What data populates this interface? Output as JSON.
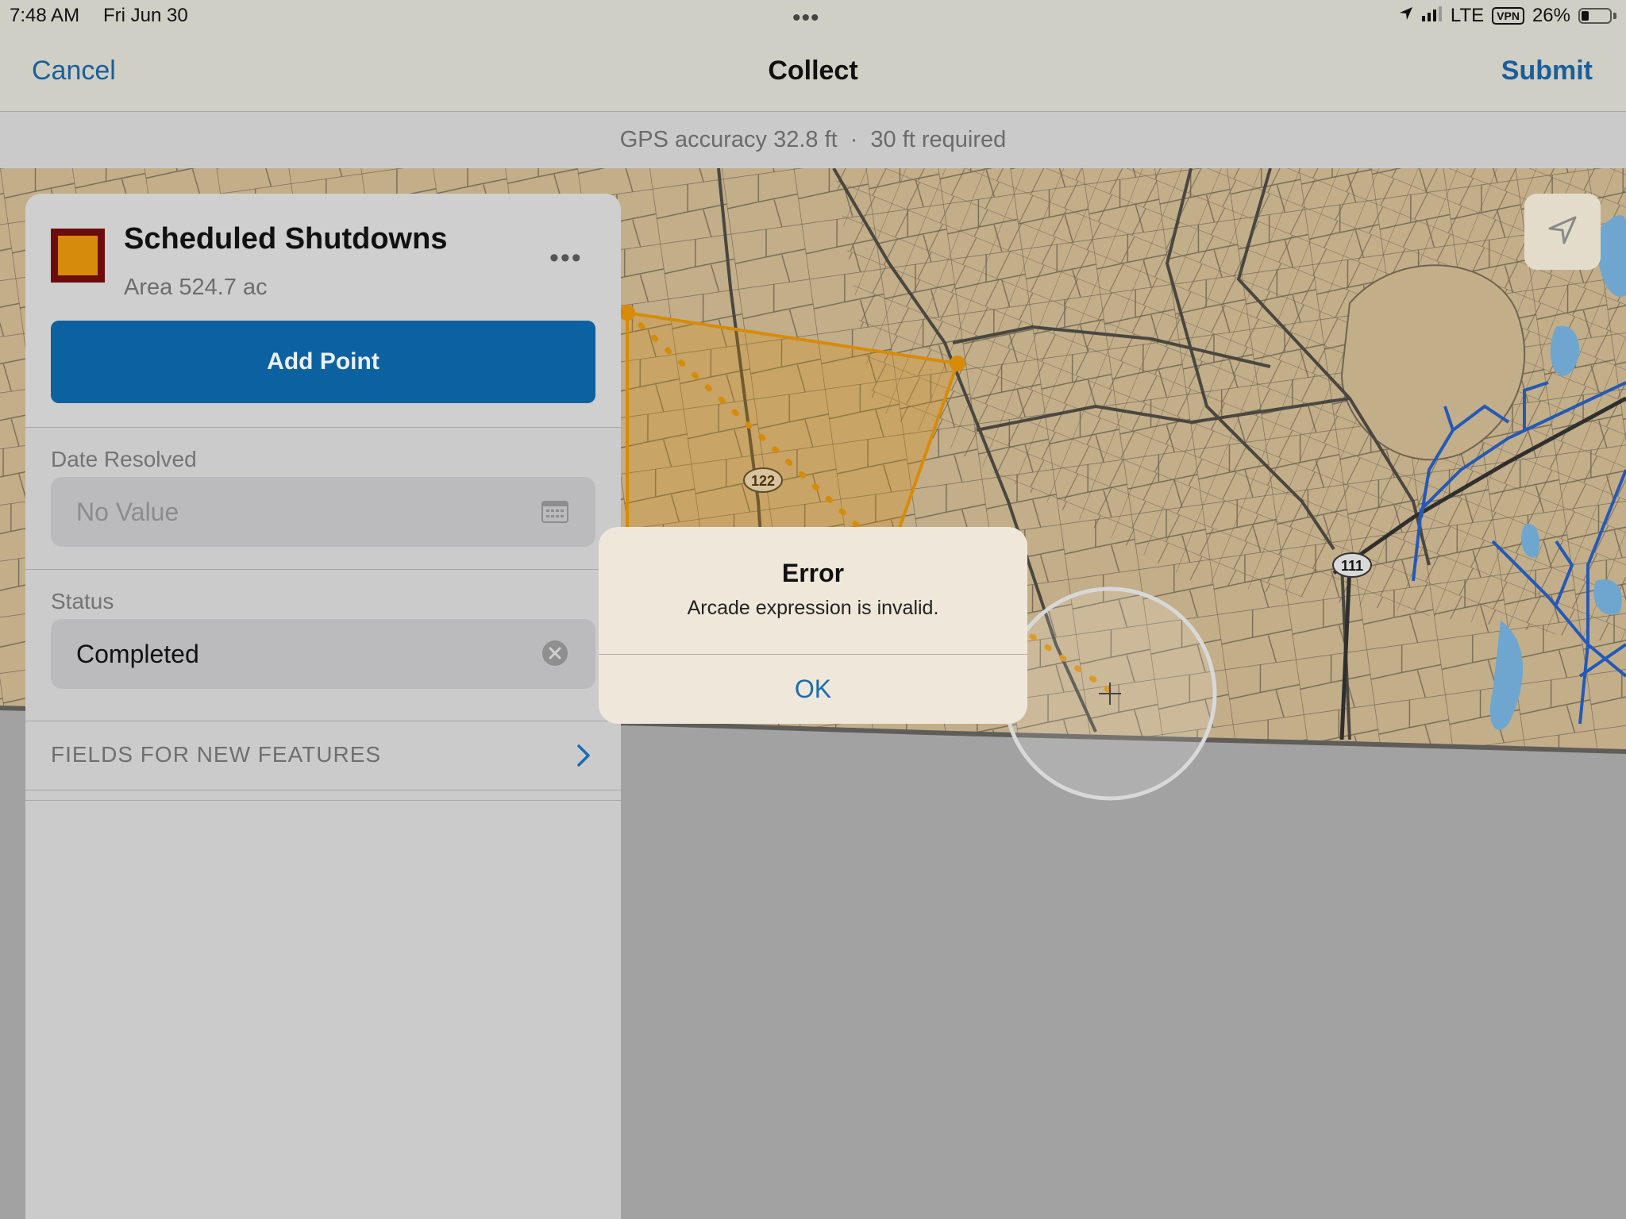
{
  "status_bar": {
    "time": "7:48 AM",
    "date": "Fri Jun 30",
    "network": "LTE",
    "vpn": "VPN",
    "battery": "26%",
    "battery_level": 0.26
  },
  "nav": {
    "cancel": "Cancel",
    "title": "Collect",
    "submit": "Submit"
  },
  "gps": {
    "accuracy": "GPS accuracy 32.8 ft",
    "separator": "·",
    "required": "30 ft required"
  },
  "feature": {
    "title": "Scheduled Shutdowns",
    "subtitle": "Area 524.7 ac",
    "swatch_fill": "#d68b0a",
    "swatch_outline": "#6d0c0c"
  },
  "actions": {
    "add_point": "Add Point"
  },
  "fields": {
    "date_resolved": {
      "label": "Date Resolved",
      "placeholder": "No Value",
      "icon": "calendar-icon"
    },
    "status": {
      "label": "Status",
      "value": "Completed",
      "icon": "clear-icon"
    }
  },
  "sections": {
    "fields_for_new_features": "FIELDS FOR NEW FEATURES"
  },
  "map": {
    "route_labels": [
      "122",
      "111"
    ],
    "accent_polygon": "#d68b0a",
    "water": "#6fa6cf",
    "utility_lines": "#2459b7"
  },
  "alert": {
    "title": "Error",
    "message": "Arcade expression is invalid.",
    "ok": "OK"
  }
}
